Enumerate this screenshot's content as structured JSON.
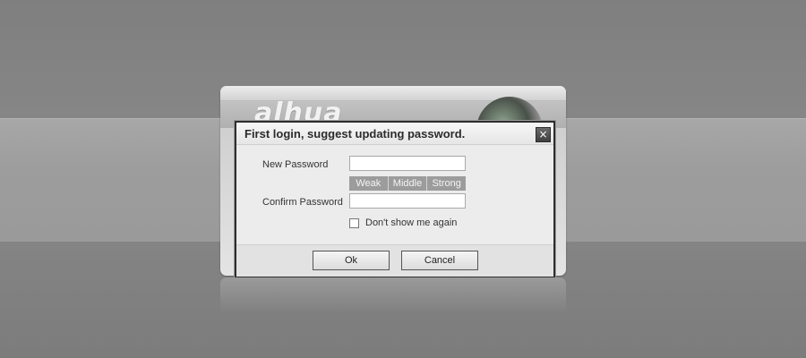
{
  "background": {
    "brand_logo": "alhua"
  },
  "dialog": {
    "title": "First login, suggest updating password.",
    "close_icon": "×",
    "new_password_label": "New Password",
    "confirm_password_label": "Confirm Password",
    "new_password_value": "",
    "confirm_password_value": "",
    "strength": {
      "weak": "Weak",
      "middle": "Middle",
      "strong": "Strong"
    },
    "dont_show_label": "Don't show me again",
    "dont_show_checked": false,
    "ok_label": "Ok",
    "cancel_label": "Cancel"
  },
  "colors": {
    "page_background": "#828282",
    "dialog_border": "#2e2e2e",
    "strength_segment": "#9c9c9c"
  }
}
